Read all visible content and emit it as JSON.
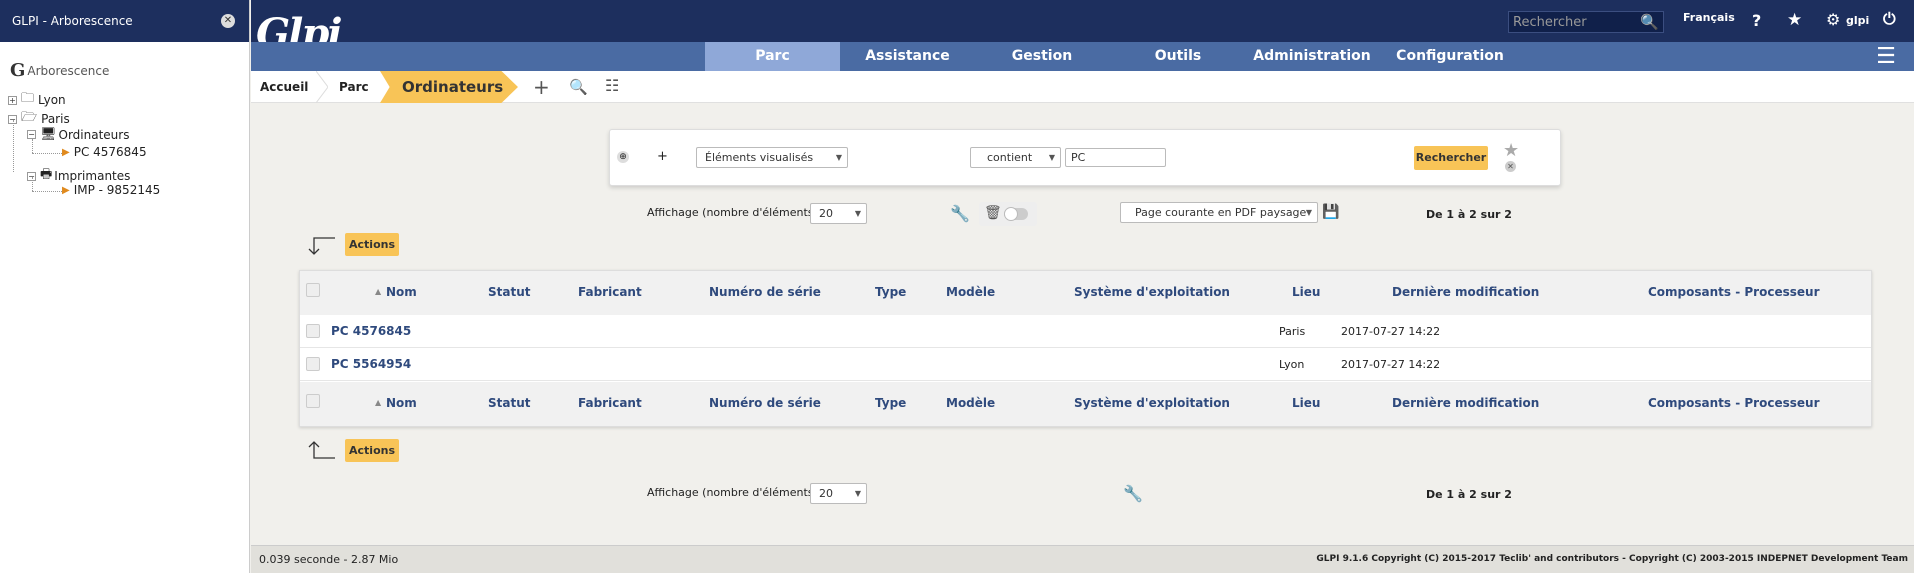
{
  "sidebar": {
    "title": "GLPI - Arborescence",
    "root_label": "Arborescence",
    "tree": {
      "lyon": "Lyon",
      "paris": "Paris",
      "ordinateurs": "Ordinateurs",
      "pc": "PC 4576845",
      "imprimantes": "Imprimantes",
      "imp": "IMP - 9852145"
    }
  },
  "header": {
    "logo": "Glpi",
    "search_placeholder": "Rechercher",
    "language": "Français",
    "user": "glpi"
  },
  "nav": [
    "Parc",
    "Assistance",
    "Gestion",
    "Outils",
    "Administration",
    "Configuration"
  ],
  "breadcrumb": {
    "home": "Accueil",
    "parc": "Parc",
    "current": "Ordinateurs"
  },
  "search": {
    "field": "Éléments visualisés",
    "operator": "contient",
    "value": "PC",
    "button": "Rechercher"
  },
  "display": {
    "label": "Affichage (nombre d'éléments)",
    "count": "20",
    "export": "Page courante en PDF paysage",
    "pagination": "De 1 à 2 sur 2",
    "actions": "Actions"
  },
  "table": {
    "columns": [
      "Nom",
      "Statut",
      "Fabricant",
      "Numéro de série",
      "Type",
      "Modèle",
      "Système d'exploitation",
      "Lieu",
      "Dernière modification",
      "Composants - Processeur"
    ],
    "rows": [
      {
        "nom": "PC 4576845",
        "lieu": "Paris",
        "modif": "2017-07-27 14:22"
      },
      {
        "nom": "PC 5564954",
        "lieu": "Lyon",
        "modif": "2017-07-27 14:22"
      }
    ]
  },
  "footer": {
    "timing": "0.039 seconde - 2.87 Mio",
    "copyright": "GLPI 9.1.6 Copyright (C) 2015-2017 Teclib' and contributors - Copyright (C) 2003-2015 INDEPNET Development Team"
  }
}
